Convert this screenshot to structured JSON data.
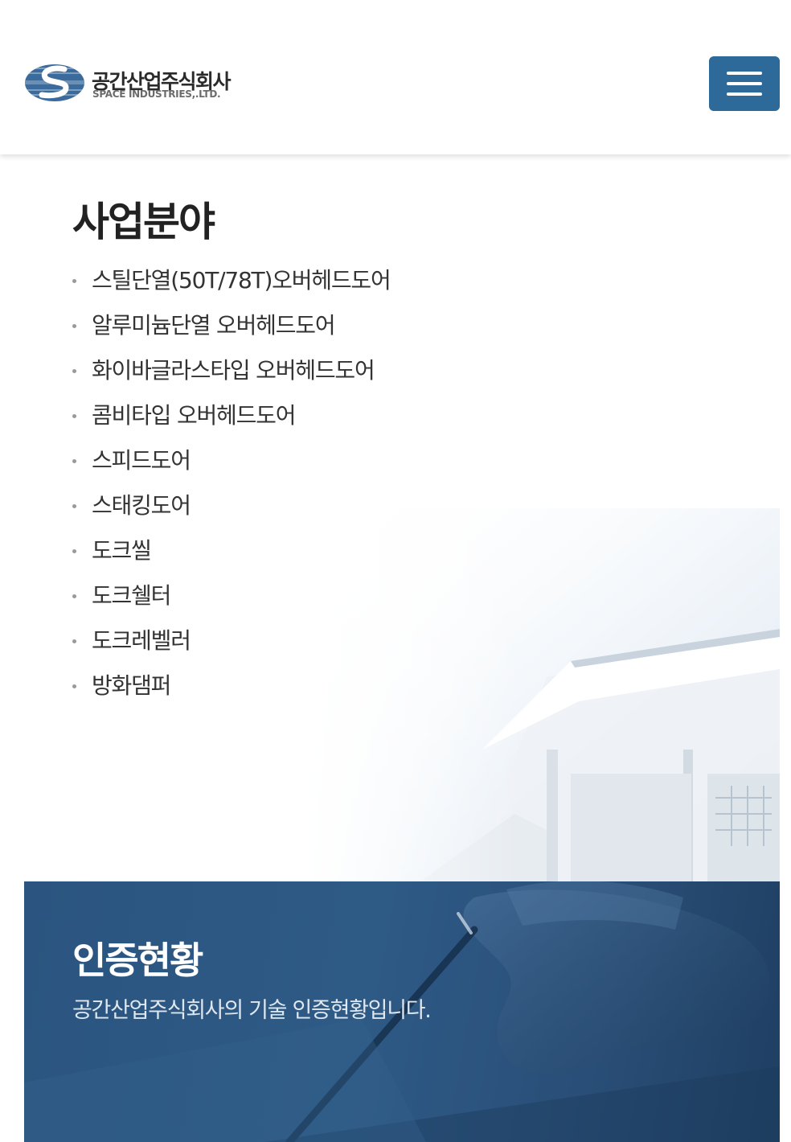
{
  "header": {
    "logo_korean": "공간산업주식회사",
    "logo_english": "SPACE INDUSTRIES,.LTD.",
    "menu_icon": "hamburger-menu-icon"
  },
  "business": {
    "title": "사업분야",
    "items": [
      "스틸단열(50T/78T)오버헤드도어",
      "알루미늄단열 오버헤드도어",
      "화이바글라스타입 오버헤드도어",
      "콤비타입 오버헤드도어",
      "스피드도어",
      "스태킹도어",
      "도크씰",
      "도크쉘터",
      "도크레벨러",
      "방화댐퍼"
    ]
  },
  "certification": {
    "title": "인증현황",
    "description": "공간산업주식회사의 기술 인증현황입니다."
  },
  "colors": {
    "menu_button": "#2e6a99",
    "cert_banner": "#2e5a86",
    "logo_blue": "#2f5f8f"
  }
}
